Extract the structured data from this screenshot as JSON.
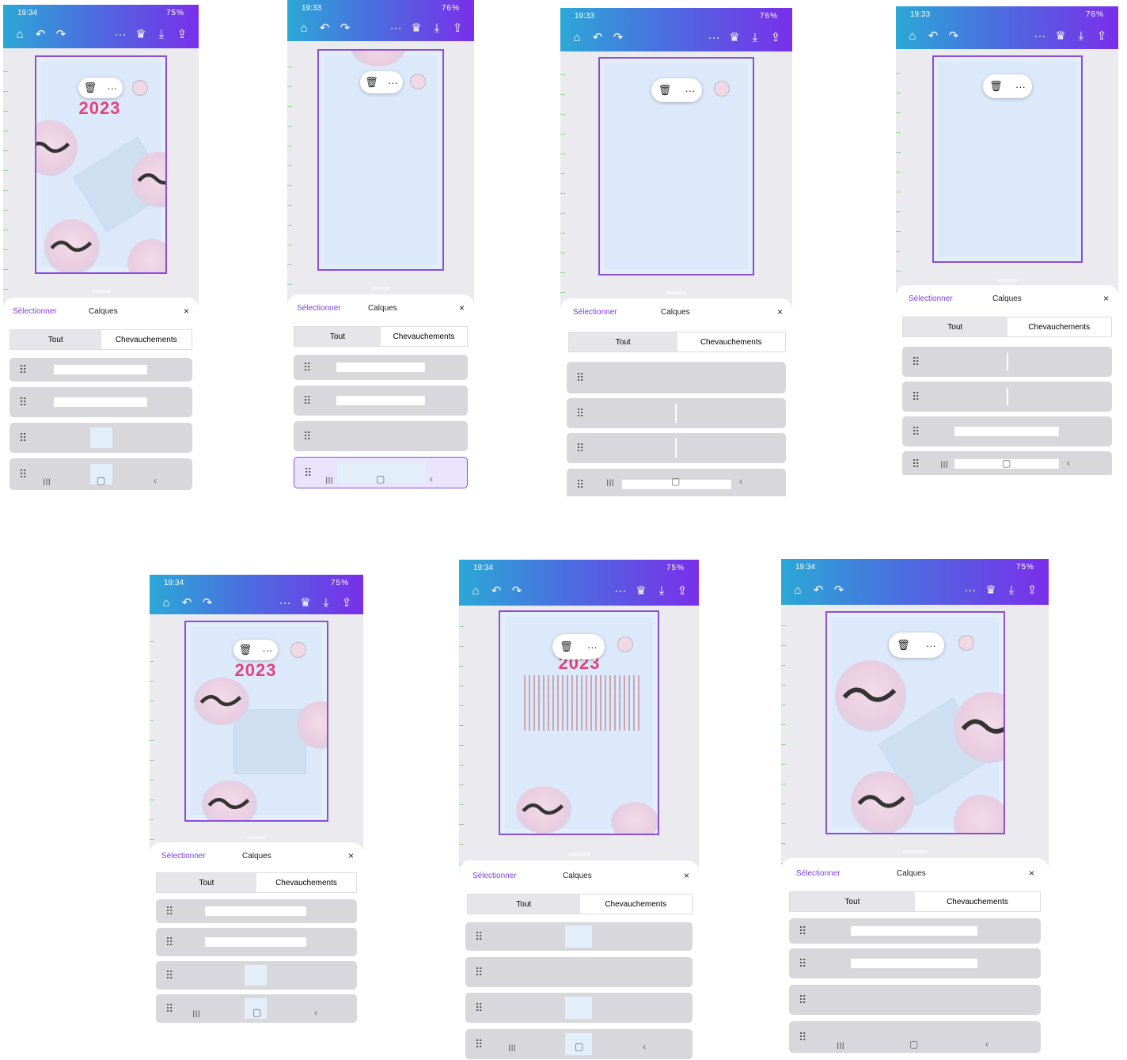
{
  "toolbar": {
    "home": "⌂",
    "undo": "↶",
    "redo": "↷",
    "more": "···",
    "crown": "♛",
    "download": "⤓",
    "share": "⇪"
  },
  "popup": {
    "delete": "🗑",
    "more": "···"
  },
  "panel": {
    "select": "Sélectionner",
    "layers": "Calques",
    "close": "×",
    "tab_all": "Tout",
    "tab_overlaps": "Chevauchements"
  },
  "nav": {
    "recent": "III",
    "home": "▢",
    "back": "‹"
  },
  "grip": "⠿",
  "year_text": "2023",
  "screens": [
    {
      "time": "19:34",
      "battery": "75%",
      "show_year": true
    },
    {
      "time": "19:33",
      "battery": "76%",
      "show_year": false
    },
    {
      "time": "19:33",
      "battery": "76%",
      "show_year": false
    },
    {
      "time": "19:33",
      "battery": "76%",
      "show_year": false
    },
    {
      "time": "19:34",
      "battery": "75%",
      "show_year": true
    },
    {
      "time": "19:34",
      "battery": "75%",
      "show_year": true
    },
    {
      "time": "19:34",
      "battery": "75%",
      "show_year": false
    }
  ]
}
